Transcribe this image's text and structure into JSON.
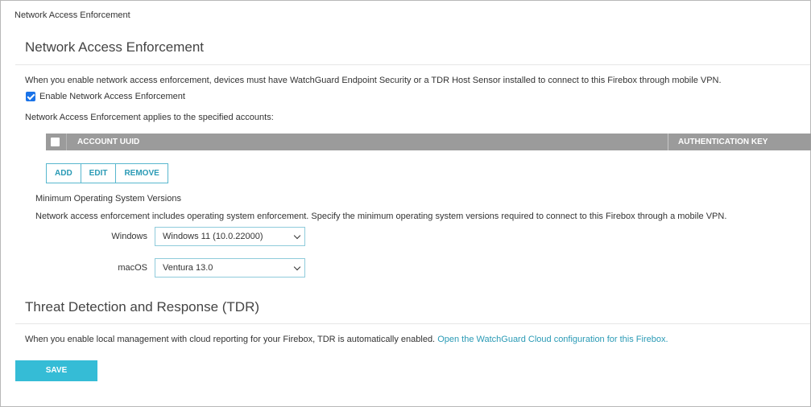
{
  "breadcrumb": "Network Access Enforcement",
  "nae": {
    "title": "Network Access Enforcement",
    "description": "When you enable network access enforcement, devices must have WatchGuard Endpoint Security or a TDR Host Sensor installed to connect to this Firebox through mobile VPN.",
    "enable_label": "Enable Network Access Enforcement",
    "enable_checked": true,
    "applies_text": "Network Access Enforcement applies to the specified accounts:",
    "table": {
      "columns": [
        "ACCOUNT UUID",
        "AUTHENTICATION KEY"
      ],
      "rows": []
    },
    "buttons": {
      "add": "ADD",
      "edit": "EDIT",
      "remove": "REMOVE"
    },
    "min_os_heading": "Minimum Operating System Versions",
    "min_os_text": "Network access enforcement includes operating system enforcement. Specify the minimum operating system versions required to connect to this Firebox through a mobile VPN.",
    "windows_label": "Windows",
    "windows_value": "Windows 11 (10.0.22000)",
    "macos_label": "macOS",
    "macos_value": "Ventura 13.0"
  },
  "tdr": {
    "title": "Threat Detection and Response (TDR)",
    "text": "When you enable local management with cloud reporting for your Firebox, TDR is automatically enabled.",
    "link": "Open the WatchGuard Cloud configuration for this Firebox."
  },
  "save_label": "SAVE",
  "colors": {
    "accent": "#35bcd6",
    "link": "#2a9ab5",
    "table_header": "#9b9b9b",
    "checkbox": "#1a73e8"
  }
}
